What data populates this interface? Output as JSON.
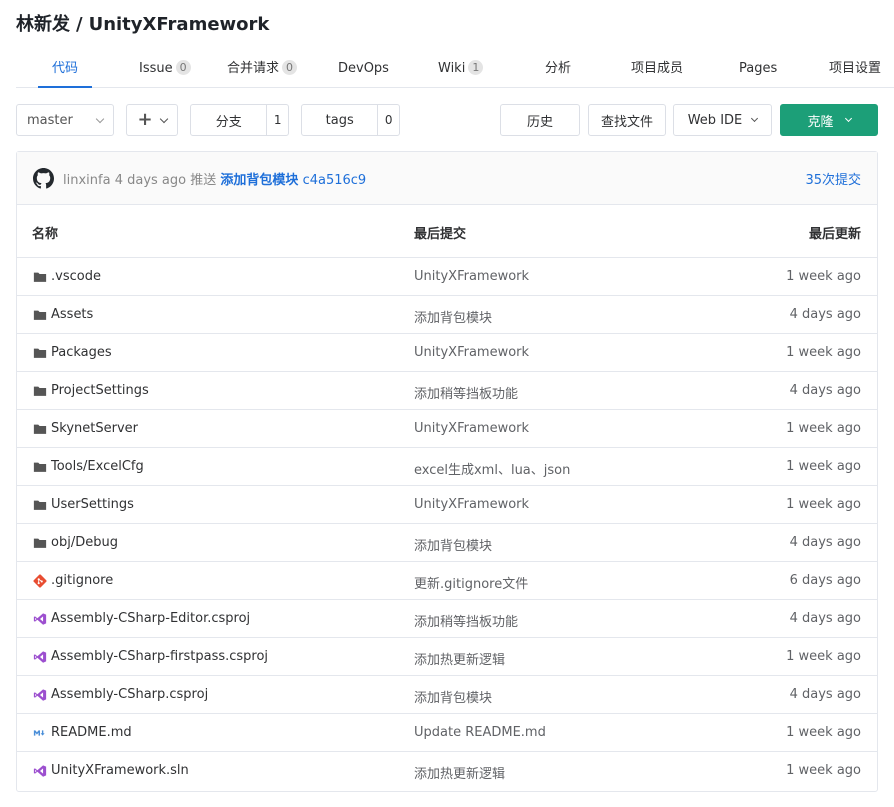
{
  "repo": {
    "owner": "林新发",
    "separator": "/",
    "name": "UnityXFramework"
  },
  "tabs": [
    {
      "label": "代码",
      "count": null,
      "active": true
    },
    {
      "label": "Issue",
      "count": "0"
    },
    {
      "label": "合并请求",
      "count": "0"
    },
    {
      "label": "DevOps",
      "count": null
    },
    {
      "label": "Wiki",
      "count": "1"
    },
    {
      "label": "分析",
      "count": null
    },
    {
      "label": "项目成员",
      "count": null
    },
    {
      "label": "Pages",
      "count": null
    },
    {
      "label": "项目设置",
      "count": null
    }
  ],
  "toolbar": {
    "branch": "master",
    "branches_label": "分支",
    "branches_count": "1",
    "tags_label": "tags",
    "tags_count": "0",
    "history_label": "历史",
    "find_file_label": "查找文件",
    "web_ide_label": "Web IDE",
    "clone_label": "克隆"
  },
  "last_commit": {
    "author": "linxinfa",
    "time": "4 days ago",
    "action": "推送",
    "message": "添加背包模块",
    "sha": "c4a516c9",
    "commits_link": "35次提交"
  },
  "table": {
    "headers": {
      "name": "名称",
      "commit": "最后提交",
      "updated": "最后更新"
    },
    "rows": [
      {
        "icon": "folder-icon",
        "name": ".vscode",
        "commit": "UnityXFramework",
        "time": "1 week ago"
      },
      {
        "icon": "folder-icon",
        "name": "Assets",
        "commit": "添加背包模块",
        "time": "4 days ago"
      },
      {
        "icon": "folder-icon",
        "name": "Packages",
        "commit": "UnityXFramework",
        "time": "1 week ago"
      },
      {
        "icon": "folder-icon",
        "name": "ProjectSettings",
        "commit": "添加稍等挡板功能",
        "time": "4 days ago"
      },
      {
        "icon": "folder-icon",
        "name": "SkynetServer",
        "commit": "UnityXFramework",
        "time": "1 week ago"
      },
      {
        "icon": "folder-icon",
        "name": "Tools/ExcelCfg",
        "commit": "excel生成xml、lua、json",
        "time": "1 week ago"
      },
      {
        "icon": "folder-icon",
        "name": "UserSettings",
        "commit": "UnityXFramework",
        "time": "1 week ago"
      },
      {
        "icon": "folder-icon",
        "name": "obj/Debug",
        "commit": "添加背包模块",
        "time": "4 days ago"
      },
      {
        "icon": "git-icon",
        "name": ".gitignore",
        "commit": "更新.gitignore文件",
        "time": "6 days ago"
      },
      {
        "icon": "visual-studio-icon",
        "name": "Assembly-CSharp-Editor.csproj",
        "commit": "添加稍等挡板功能",
        "time": "4 days ago"
      },
      {
        "icon": "visual-studio-icon",
        "name": "Assembly-CSharp-firstpass.csproj",
        "commit": "添加热更新逻辑",
        "time": "1 week ago"
      },
      {
        "icon": "visual-studio-icon",
        "name": "Assembly-CSharp.csproj",
        "commit": "添加背包模块",
        "time": "4 days ago"
      },
      {
        "icon": "markdown-icon",
        "name": "README.md",
        "commit": "Update README.md",
        "time": "1 week ago"
      },
      {
        "icon": "visual-studio-icon",
        "name": "UnityXFramework.sln",
        "commit": "添加热更新逻辑",
        "time": "1 week ago"
      }
    ]
  },
  "colors": {
    "accent": "#1e6fd9",
    "clone": "#1c9f78",
    "folder": "#555555",
    "git": "#e84d31",
    "vs": "#9c4fcf",
    "markdown": "#4a8ed8"
  }
}
